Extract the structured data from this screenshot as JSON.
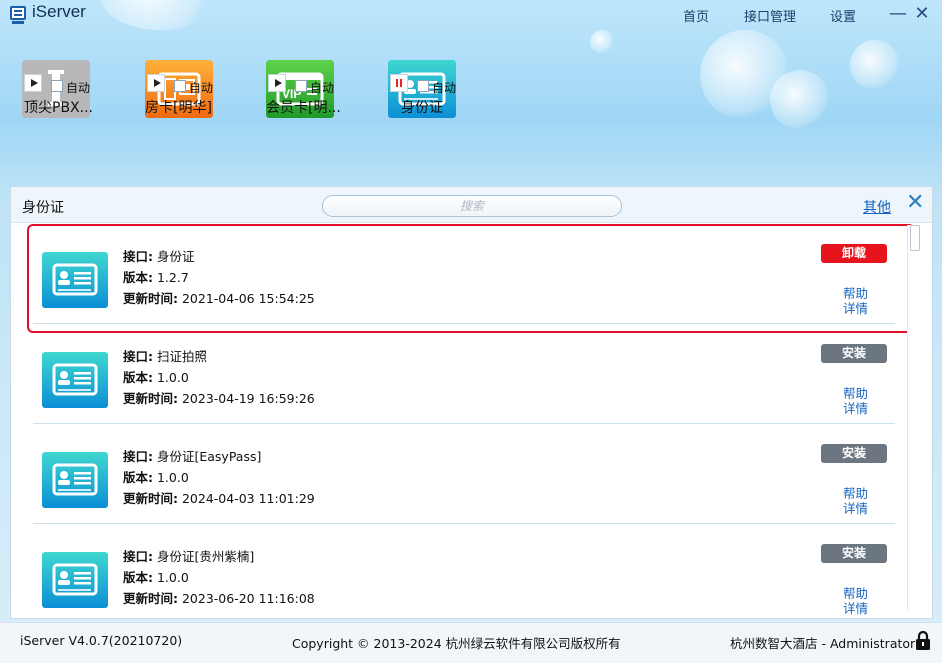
{
  "app": {
    "title": "iServer"
  },
  "nav": {
    "home": "首页",
    "interface_mgmt": "接口管理",
    "settings": "设置"
  },
  "window": {
    "minimize": "—",
    "close": "✕"
  },
  "tiles": [
    {
      "name": "顶尖PBX...",
      "auto_label": "自动",
      "state": "stopped",
      "icon": "pbx-icon"
    },
    {
      "name": "房卡[明华]",
      "auto_label": "自动",
      "state": "stopped",
      "icon": "room-card-icon"
    },
    {
      "name": "会员卡[明...",
      "auto_label": "自动",
      "state": "stopped",
      "icon": "vip-card-icon"
    },
    {
      "name": "身份证",
      "auto_label": "自动",
      "state": "running",
      "icon": "id-card-icon"
    }
  ],
  "panel": {
    "title": "身份证",
    "search_placeholder": "搜索",
    "other_link": "其他",
    "close": "✕"
  },
  "labels": {
    "interface": "接口:",
    "version": "版本:",
    "updated": "更新时间:",
    "help": "帮助",
    "details": "详情"
  },
  "rows": [
    {
      "name": "身份证",
      "version": "1.2.7",
      "updated": "2021-04-06 15:54:25",
      "action": "卸载",
      "action_type": "uninstall"
    },
    {
      "name": "扫证拍照",
      "version": "1.0.0",
      "updated": "2023-04-19 16:59:26",
      "action": "安装",
      "action_type": "install"
    },
    {
      "name": "身份证[EasyPass]",
      "version": "1.0.0",
      "updated": "2024-04-03 11:01:29",
      "action": "安装",
      "action_type": "install"
    },
    {
      "name": "身份证[贵州紫楠]",
      "version": "1.0.0",
      "updated": "2023-06-20 11:16:08",
      "action": "安装",
      "action_type": "install"
    }
  ],
  "footer": {
    "version": "iServer V4.0.7(20210720)",
    "copyright": "Copyright © 2013-2024 杭州绿云软件有限公司版权所有",
    "user": "杭州数智大酒店 - Administrator"
  },
  "colors": {
    "accent": "#1260c2",
    "uninstall": "#e8141d",
    "install": "#6c7680",
    "highlight": "#e0102a"
  }
}
